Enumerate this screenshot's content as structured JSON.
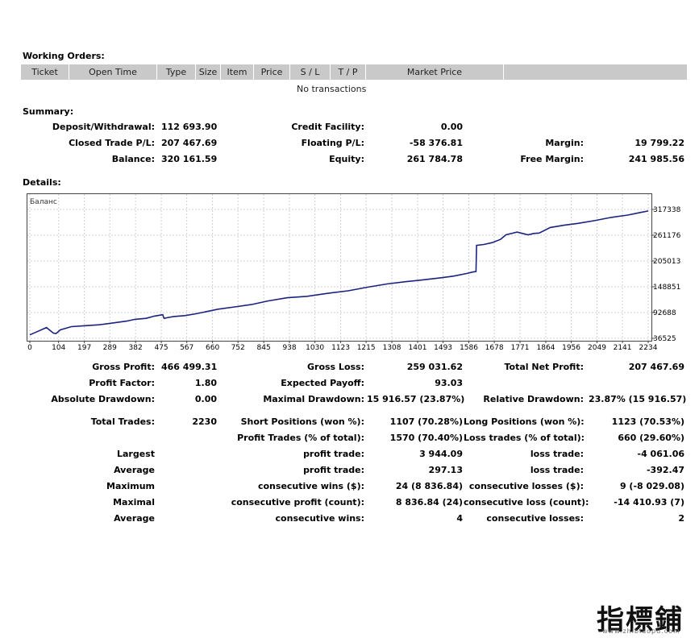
{
  "working_orders": {
    "title": "Working Orders:",
    "columns": [
      "Ticket",
      "Open Time",
      "Type",
      "Size",
      "Item",
      "Price",
      "S / L",
      "T / P",
      "Market Price",
      ""
    ],
    "empty_text": "No transactions"
  },
  "summary": {
    "title": "Summary:",
    "rows": [
      {
        "l1": "Deposit/Withdrawal:",
        "v1": "112 693.90",
        "l2": "Credit Facility:",
        "v2": "0.00",
        "l3": "",
        "v3": ""
      },
      {
        "l1": "Closed Trade P/L:",
        "v1": "207 467.69",
        "l2": "Floating P/L:",
        "v2": "-58 376.81",
        "l3": "Margin:",
        "v3": "19 799.22"
      },
      {
        "l1": "Balance:",
        "v1": "320 161.59",
        "l2": "Equity:",
        "v2": "261 784.78",
        "l3": "Free Margin:",
        "v3": "241 985.56"
      }
    ]
  },
  "details": {
    "title": "Details:"
  },
  "chart_data": {
    "type": "line",
    "legend": "Баланс",
    "x_ticks": [
      "0",
      "104",
      "197",
      "289",
      "382",
      "475",
      "567",
      "660",
      "752",
      "845",
      "938",
      "1030",
      "1123",
      "1215",
      "1308",
      "1401",
      "1493",
      "1586",
      "1678",
      "1771",
      "1864",
      "1956",
      "2049",
      "2141",
      "2234"
    ],
    "y_ticks": [
      "317338",
      "261176",
      "205013",
      "148851",
      "92688",
      "36525"
    ],
    "xlim": [
      0,
      2234
    ],
    "ylim": [
      36525,
      317338
    ],
    "color": "#1a237e",
    "series": [
      {
        "x": [
          0,
          30,
          60,
          85,
          95,
          110,
          150,
          200,
          250,
          300,
          350,
          380,
          420,
          450,
          480,
          485,
          500,
          520,
          560,
          600,
          640,
          680,
          740,
          800,
          860,
          930,
          1000,
          1080,
          1150,
          1220,
          1290,
          1360,
          1420,
          1480,
          1530,
          1580,
          1600,
          1612,
          1614,
          1640,
          1670,
          1700,
          1720,
          1760,
          1780,
          1800,
          1820,
          1840,
          1880,
          1930,
          1980,
          2040,
          2100,
          2160,
          2200,
          2234
        ],
        "y": [
          44000,
          52000,
          60000,
          48000,
          47000,
          55000,
          62000,
          64000,
          66000,
          70000,
          74000,
          78000,
          80000,
          85000,
          88000,
          80000,
          82000,
          84000,
          86000,
          90000,
          95000,
          100000,
          105000,
          110000,
          118000,
          125000,
          128000,
          135000,
          140000,
          148000,
          155000,
          160000,
          164000,
          168000,
          172000,
          178000,
          181000,
          182000,
          239000,
          241000,
          245000,
          252000,
          262000,
          268000,
          265000,
          262000,
          265000,
          266000,
          278000,
          283000,
          287000,
          293000,
          300000,
          305000,
          310000,
          314000
        ]
      }
    ]
  },
  "stats": {
    "rows": [
      {
        "l1": "Gross Profit:",
        "v1": "466 499.31",
        "l2": "Gross Loss:",
        "v2": "259 031.62",
        "l3": "Total Net Profit:",
        "v3": "207 467.69"
      },
      {
        "l1": "Profit Factor:",
        "v1": "1.80",
        "l2": "Expected Payoff:",
        "v2": "93.03",
        "l3": "",
        "v3": ""
      },
      {
        "l1": "Absolute Drawdown:",
        "v1": "0.00",
        "l2": "Maximal Drawdown:",
        "v2": "15 916.57 (23.87%)",
        "l3": "Relative Drawdown:",
        "v3": "23.87% (15 916.57)"
      }
    ],
    "rows2": [
      {
        "l1": "Total Trades:",
        "v1": "2230",
        "l2": "Short Positions (won %):",
        "v2": "1107 (70.28%)",
        "l3": "Long Positions (won %):",
        "v3": "1123 (70.53%)"
      },
      {
        "l1": "",
        "v1": "",
        "l2": "Profit Trades (% of total):",
        "v2": "1570 (70.40%)",
        "l3": "Loss trades (% of total):",
        "v3": "660 (29.60%)"
      },
      {
        "l1": "Largest",
        "v1": "",
        "l2": "profit trade:",
        "v2": "3 944.09",
        "l3": "loss trade:",
        "v3": "-4 061.06"
      },
      {
        "l1": "Average",
        "v1": "",
        "l2": "profit trade:",
        "v2": "297.13",
        "l3": "loss trade:",
        "v3": "-392.47"
      },
      {
        "l1": "Maximum",
        "v1": "",
        "l2": "consecutive wins ($):",
        "v2": "24 (8 836.84)",
        "l3": "consecutive losses ($):",
        "v3": "9 (-8 029.08)"
      },
      {
        "l1": "Maximal",
        "v1": "",
        "l2": "consecutive profit (count):",
        "v2": "8 836.84 (24)",
        "l3": "consecutive loss (count):",
        "v3": "-14 410.93 (7)"
      },
      {
        "l1": "Average",
        "v1": "",
        "l2": "consecutive wins:",
        "v2": "4",
        "l3": "consecutive losses:",
        "v3": "2"
      }
    ]
  },
  "watermark": {
    "text": "指標鋪",
    "url": "www.zhibiaopu.com"
  }
}
